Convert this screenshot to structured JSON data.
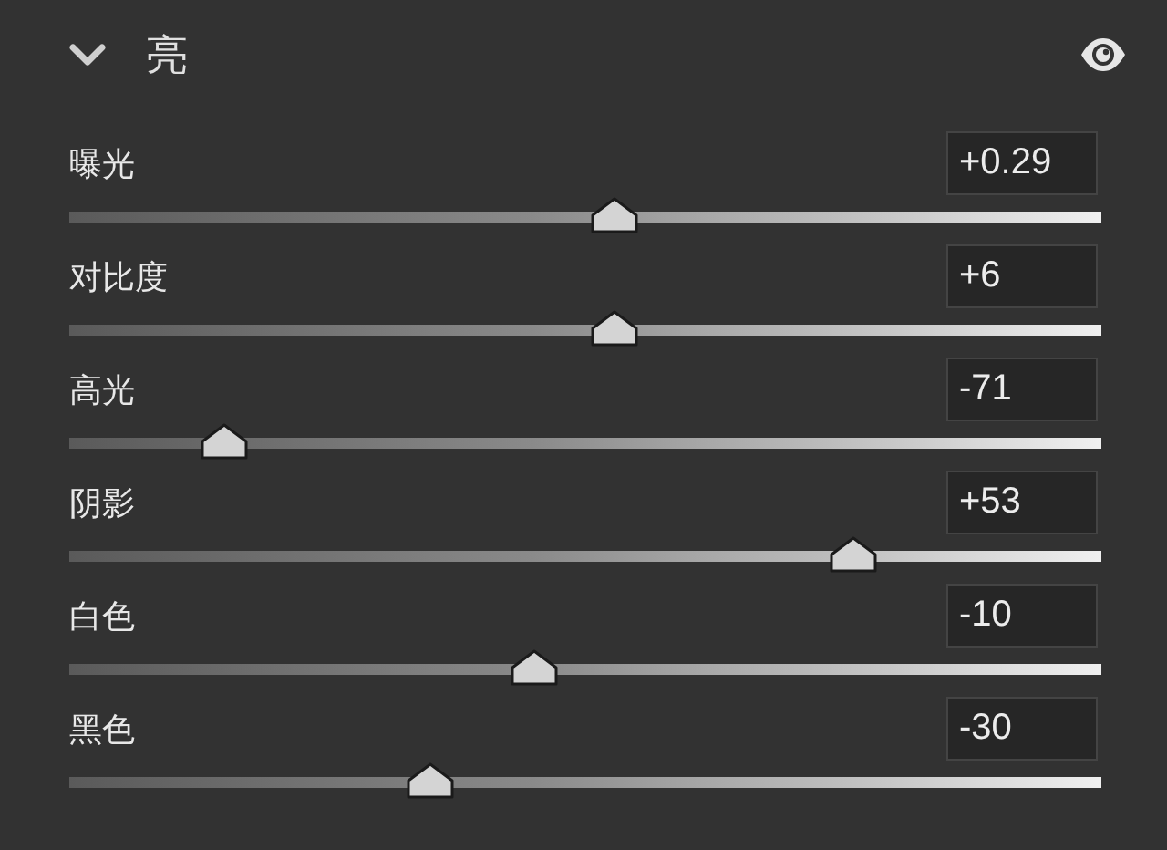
{
  "panel": {
    "title": "亮",
    "expanded": true
  },
  "sliders": [
    {
      "label": "曝光",
      "value": "+0.29",
      "level": 0.528
    },
    {
      "label": "对比度",
      "value": "+6",
      "level": 0.528
    },
    {
      "label": "高光",
      "value": "-71",
      "level": 0.15
    },
    {
      "label": "阴影",
      "value": "+53",
      "level": 0.76
    },
    {
      "label": "白色",
      "value": "-10",
      "level": 0.45
    },
    {
      "label": "黑色",
      "value": "-30",
      "level": 0.35
    }
  ]
}
